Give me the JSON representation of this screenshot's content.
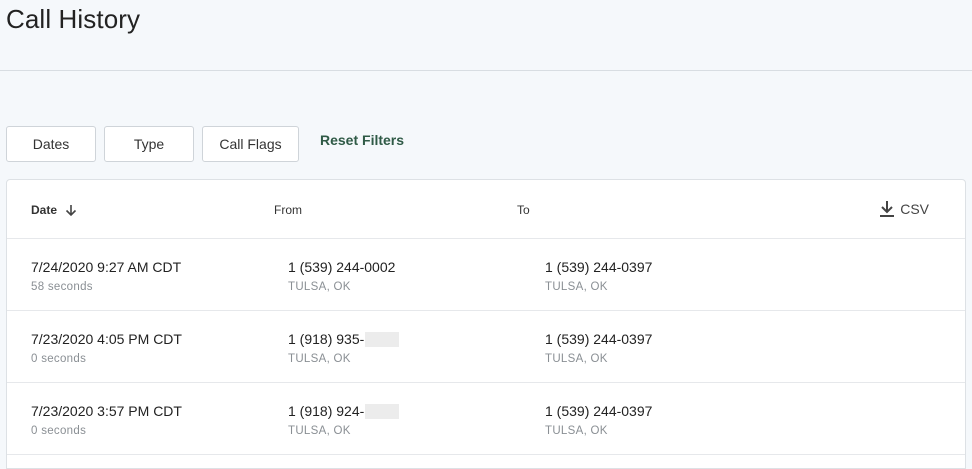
{
  "page": {
    "title": "Call History"
  },
  "filters": {
    "dates_label": "Dates",
    "type_label": "Type",
    "call_flags_label": "Call Flags",
    "reset_label": "Reset Filters"
  },
  "table": {
    "columns": {
      "date": "Date",
      "from": "From",
      "to": "To"
    },
    "sort_icon": "arrow-down-icon",
    "csv_label": "CSV",
    "csv_icon": "download-icon",
    "rows": [
      {
        "date": "7/24/2020 9:27 AM CDT",
        "duration": "58 seconds",
        "from_number": "1 (539) 244-0002",
        "from_location": "TULSA, OK",
        "to_number": "1 (539) 244-0397",
        "to_location": "TULSA, OK"
      },
      {
        "date": "7/23/2020 4:05 PM CDT",
        "duration": "0 seconds",
        "from_number": "1 (918) 935-",
        "from_location": "TULSA, OK",
        "to_number": "1 (539) 244-0397",
        "to_location": "TULSA, OK"
      },
      {
        "date": "7/23/2020 3:57 PM CDT",
        "duration": "0 seconds",
        "from_number": "1 (918) 924-",
        "from_location": "TULSA, OK",
        "to_number": "1 (539) 244-0397",
        "to_location": "TULSA, OK"
      }
    ]
  }
}
